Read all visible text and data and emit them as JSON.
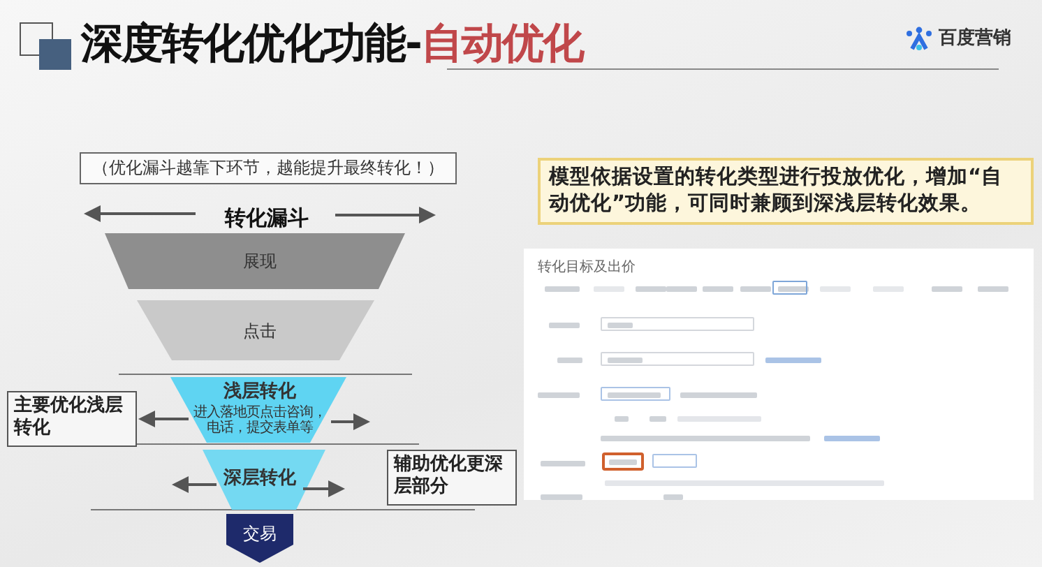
{
  "header": {
    "title": "深度转化优化功能-",
    "title_highlight": "自动优化",
    "logo_text": "百度营销"
  },
  "funnel": {
    "note": "（优化漏斗越靠下环节，越能提升最终转化！）",
    "title": "转化漏斗",
    "stages": [
      {
        "name": "展现",
        "color": "#8e8e8e"
      },
      {
        "name": "点击",
        "color": "#c9c9c9"
      },
      {
        "name": "浅层转化",
        "detail": "进入落地页点击咨询，电话，提交表单等",
        "color": "#5fd4f2"
      },
      {
        "name": "深层转化",
        "color": "#74d9f2"
      },
      {
        "name": "交易",
        "color": "#1e2a6b"
      }
    ],
    "callouts": [
      {
        "text": "主要优化浅层转化"
      },
      {
        "text": "辅助优化更深层部分"
      }
    ]
  },
  "description": "模型依据设置的转化类型进行投放优化，增加“自动优化”功能，可同时兼顾到深浅层转化效果。",
  "screenshot": {
    "title": "转化目标及出价"
  }
}
